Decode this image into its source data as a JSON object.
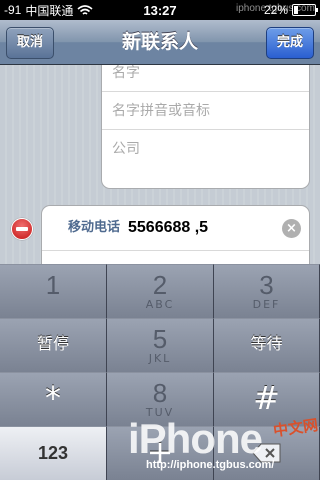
{
  "status_bar": {
    "signal": "-91",
    "carrier": "中国联通",
    "time": "13:27",
    "watermark": "iphone.tgbus.com",
    "battery": "22%",
    "battery_level": 0.22
  },
  "nav": {
    "cancel_label": "取消",
    "title": "新联系人",
    "done_label": "完成"
  },
  "name_fields": [
    {
      "placeholder": "名字"
    },
    {
      "placeholder": "名字拼音或音标"
    },
    {
      "placeholder": "公司"
    }
  ],
  "phone_field": {
    "label": "移动电话",
    "value": "5566688 ,5"
  },
  "keypad": {
    "keys": [
      {
        "num": "1",
        "letters": ""
      },
      {
        "num": "2",
        "letters": "ABC"
      },
      {
        "num": "3",
        "letters": "DEF"
      },
      {
        "num": "5",
        "letters": "JKL"
      },
      {
        "num": "8",
        "letters": "TUV"
      }
    ],
    "pause_label": "暂停",
    "wait_label": "等待",
    "star_label": "*",
    "hash_label": "#",
    "mode_label": "123",
    "plus_label": "+"
  },
  "watermark": {
    "logo": "iPhone",
    "cn": "中文网",
    "url": "http://iphone.tgbus.com/"
  },
  "colors": {
    "nav_bar": "#6d84a2",
    "done_button": "#2a5fd0",
    "delete_button": "#c41414",
    "field_label": "#4f6a8f"
  }
}
